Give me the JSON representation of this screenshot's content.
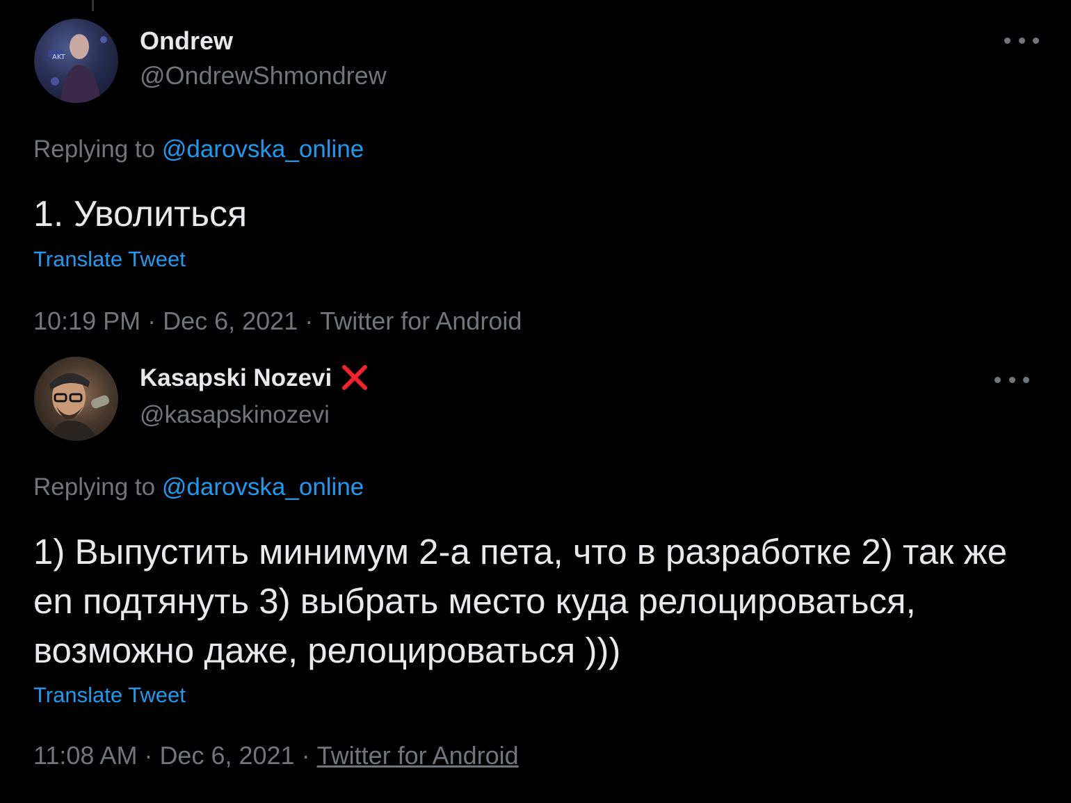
{
  "tweets": [
    {
      "display_name": "Ondrew",
      "handle": "@OndrewShmondrew",
      "replying_prefix": "Replying to",
      "replying_to": "@darovska_online",
      "text": "1. Уволиться",
      "translate_label": "Translate Tweet",
      "time": "10:19 PM",
      "date": "Dec 6, 2021",
      "source": "Twitter for Android",
      "avatar_icon": "user-avatar-photo"
    },
    {
      "display_name": "Kasapski Nozevi",
      "name_badge_icon": "red-cross-mark-icon",
      "handle": "@kasapskinozevi",
      "replying_prefix": "Replying to",
      "replying_to": "@darovska_online",
      "text": "1) Выпустить минимум 2-а пета, что в разработке 2) так же en подтянуть 3) выбрать место куда релоцироваться, возможно даже, релоцироваться )))",
      "translate_label": "Translate Tweet",
      "time": "11:08 AM",
      "date": "Dec 6, 2021",
      "source": "Twitter for Android",
      "avatar_icon": "user-avatar-photo"
    }
  ],
  "separator": "·",
  "colors": {
    "background": "#000000",
    "primary_text": "#e7e9ea",
    "secondary_text": "#71767b",
    "link": "#1d9bf0",
    "badge_red": "#f4212e"
  }
}
